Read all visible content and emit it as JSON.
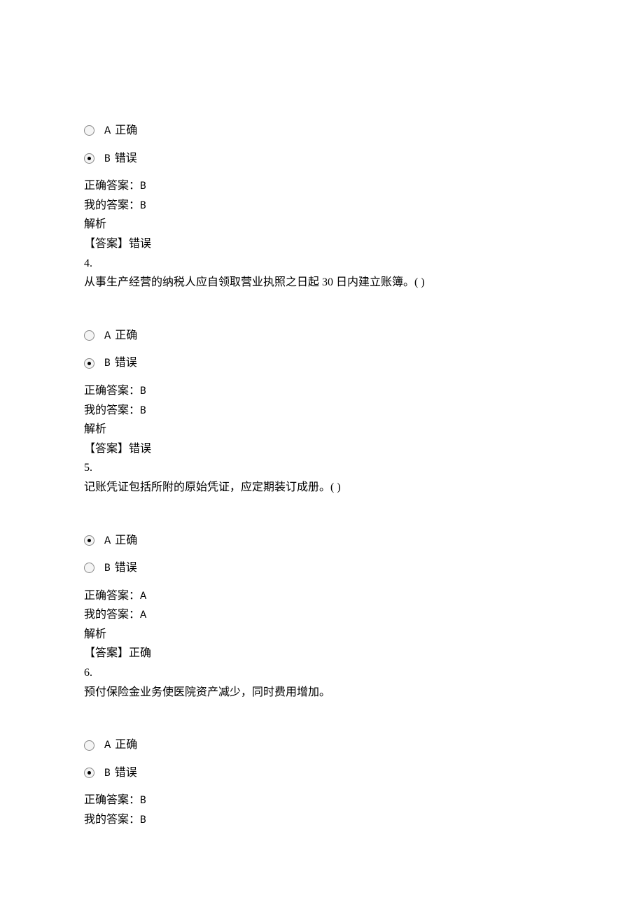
{
  "labels": {
    "correct_answer_prefix": "正确答案：",
    "my_answer_prefix": "我的答案：",
    "analysis_label": "解析",
    "answer_bracket_prefix": "【答案】",
    "option_a_letter": "A",
    "option_b_letter": "B",
    "option_correct_text": "正确",
    "option_wrong_text": "错误"
  },
  "questions": [
    {
      "number": "",
      "text": "",
      "selected": "B",
      "correct_answer": "B",
      "my_answer": "B",
      "analysis_value": "错误"
    },
    {
      "number": "4.",
      "text": "从事生产经营的纳税人应自领取营业执照之日起 30 日内建立账簿。(  )",
      "selected": "B",
      "correct_answer": "B",
      "my_answer": "B",
      "analysis_value": "错误"
    },
    {
      "number": "5.",
      "text": "记账凭证包括所附的原始凭证，应定期装订成册。(  )",
      "selected": "A",
      "correct_answer": "A",
      "my_answer": "A",
      "analysis_value": "正确"
    },
    {
      "number": "6.",
      "text": "预付保险金业务使医院资产减少，同时费用增加。",
      "selected": "B",
      "correct_answer": "B",
      "my_answer": "B",
      "analysis_value": ""
    }
  ]
}
